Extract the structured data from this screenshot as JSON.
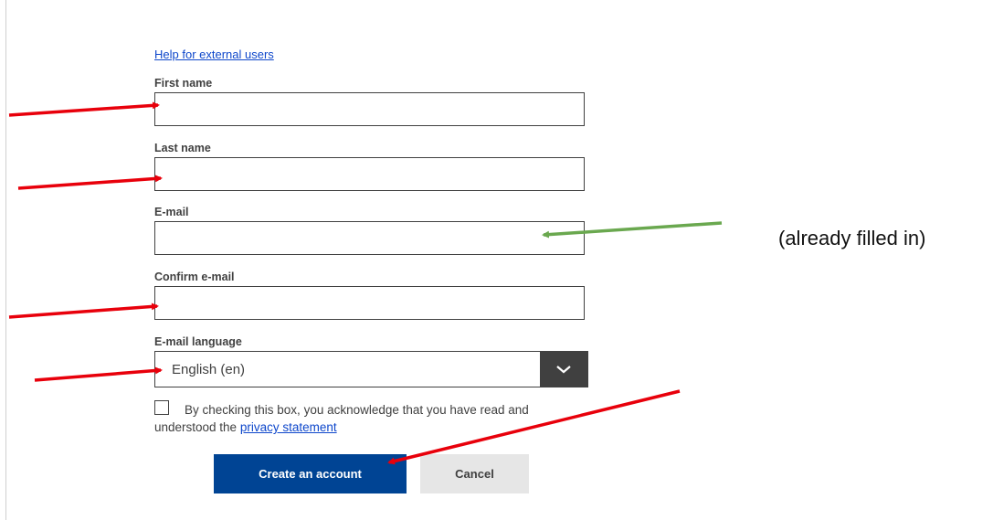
{
  "help_link": "Help for external users",
  "form": {
    "first_name": {
      "label": "First name",
      "value": ""
    },
    "last_name": {
      "label": "Last name",
      "value": ""
    },
    "email": {
      "label": "E-mail",
      "value": ""
    },
    "confirm_email": {
      "label": "Confirm e-mail",
      "value": ""
    },
    "email_language": {
      "label": "E-mail language",
      "selected": "English (en)"
    },
    "consent": {
      "checked": false,
      "text_before": "By checking this box, you acknowledge that you have read and understood the ",
      "link_text": "privacy statement"
    }
  },
  "buttons": {
    "create": "Create an account",
    "cancel": "Cancel"
  },
  "annotation_note": "(already filled in)",
  "colors": {
    "primary_button": "#004494",
    "link": "#0e47cb",
    "red_arrow": "#e8000b",
    "green_arrow": "#6aa84f"
  },
  "icons": {
    "select_toggle": "chevron-down-icon",
    "red_arrow": "arrow-right-icon",
    "green_arrow": "arrow-left-icon"
  }
}
